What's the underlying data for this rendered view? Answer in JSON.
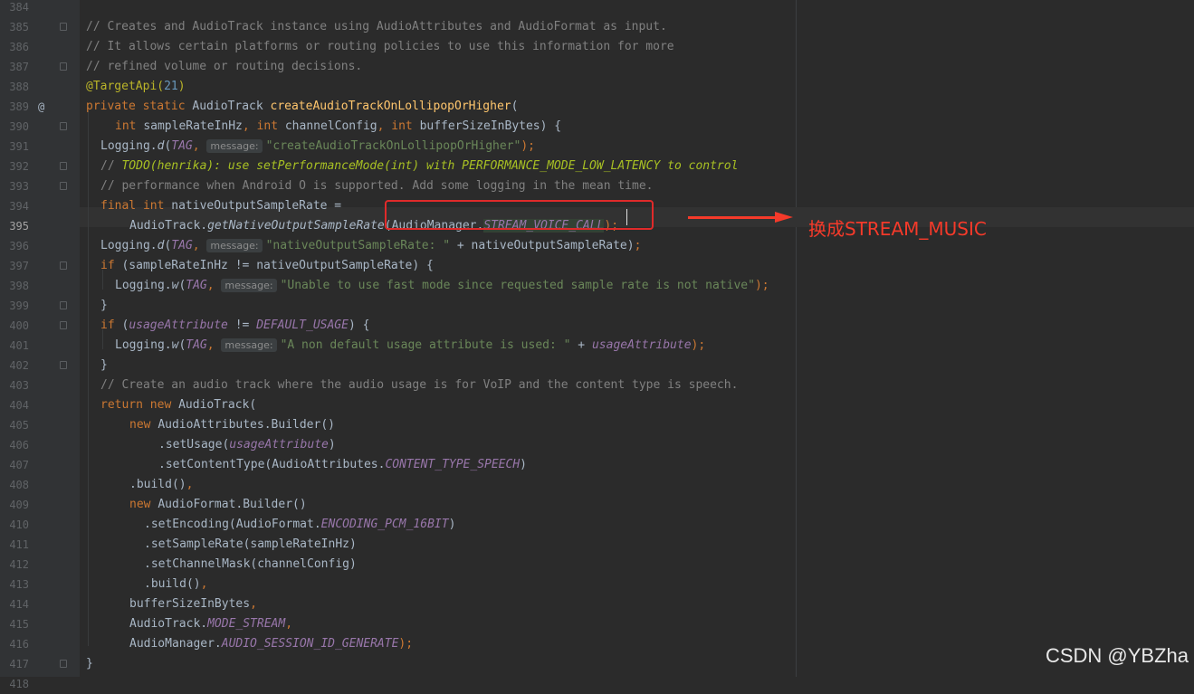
{
  "editor": {
    "current_line": "395",
    "lines": [
      {
        "n": "384",
        "fold": false,
        "icon": "",
        "indent": 95,
        "segments": []
      },
      {
        "n": "385",
        "fold": true,
        "icon": "",
        "indent": 95,
        "segments": [
          {
            "t": "// Creates and AudioTrack instance using AudioAttributes and AudioFormat as input.",
            "c": "cm"
          }
        ]
      },
      {
        "n": "386",
        "fold": false,
        "icon": "",
        "indent": 95,
        "segments": [
          {
            "t": "// It allows certain platforms or routing policies to use this information for more",
            "c": "cm"
          }
        ]
      },
      {
        "n": "387",
        "fold": true,
        "icon": "",
        "indent": 95,
        "segments": [
          {
            "t": "// refined volume or routing decisions.",
            "c": "cm"
          }
        ]
      },
      {
        "n": "388",
        "fold": false,
        "icon": "",
        "indent": 95,
        "segments": [
          {
            "t": "@TargetApi(",
            "c": "ann"
          },
          {
            "t": "21",
            "c": "num"
          },
          {
            "t": ")",
            "c": "ann"
          }
        ]
      },
      {
        "n": "389",
        "fold": false,
        "icon": "@",
        "indent": 95,
        "segments": [
          {
            "t": "private static ",
            "c": "kw"
          },
          {
            "t": "AudioTrack ",
            "c": ""
          },
          {
            "t": "createAudioTrackOnLollipopOrHigher",
            "c": "fn"
          },
          {
            "t": "(",
            "c": ""
          }
        ]
      },
      {
        "n": "390",
        "fold": true,
        "icon": "",
        "indent": 127,
        "segments": [
          {
            "t": "int ",
            "c": "kw"
          },
          {
            "t": "sampleRateInHz",
            "c": ""
          },
          {
            "t": ", ",
            "c": "kw"
          },
          {
            "t": "int ",
            "c": "kw"
          },
          {
            "t": "channelConfig",
            "c": ""
          },
          {
            "t": ", ",
            "c": "kw"
          },
          {
            "t": "int ",
            "c": "kw"
          },
          {
            "t": "bufferSizeInBytes",
            "c": ""
          },
          {
            "t": ") {",
            "c": ""
          }
        ]
      },
      {
        "n": "391",
        "fold": false,
        "icon": "",
        "indent": 111,
        "segments": [
          {
            "t": "Logging.",
            "c": ""
          },
          {
            "t": "d",
            "c": "mi"
          },
          {
            "t": "(",
            "c": ""
          },
          {
            "t": "TAG",
            "c": "st"
          },
          {
            "t": ", ",
            "c": "kw"
          },
          {
            "t": "message:",
            "c": "hint"
          },
          {
            "t": "\"createAudioTrackOnLollipopOrHigher\"",
            "c": "str"
          },
          {
            "t": ");",
            "c": "kw"
          }
        ]
      },
      {
        "n": "392",
        "fold": true,
        "icon": "",
        "indent": 111,
        "segments": [
          {
            "t": "// ",
            "c": "cm"
          },
          {
            "t": "TODO(henrika): use setPerformanceMode(int) with PERFORMANCE_MODE_LOW_LATENCY to control",
            "c": "todo"
          }
        ]
      },
      {
        "n": "393",
        "fold": true,
        "icon": "",
        "indent": 111,
        "segments": [
          {
            "t": "// performance when Android O is supported. Add some logging in the mean time.",
            "c": "cm"
          }
        ]
      },
      {
        "n": "394",
        "fold": false,
        "icon": "",
        "indent": 111,
        "segments": [
          {
            "t": "final int ",
            "c": "kw"
          },
          {
            "t": "nativeOutputSampleRate =",
            "c": ""
          }
        ]
      },
      {
        "n": "395",
        "fold": false,
        "icon": "",
        "indent": 143,
        "segments": [
          {
            "t": "AudioTrack.",
            "c": ""
          },
          {
            "t": "getNativeOutputSampleRate",
            "c": "mi"
          },
          {
            "t": "(AudioManager.",
            "c": ""
          },
          {
            "t": "STREAM_VOICE_CALL",
            "c": "st sel"
          },
          {
            "t": ");",
            "c": "kw"
          }
        ]
      },
      {
        "n": "396",
        "fold": false,
        "icon": "",
        "indent": 111,
        "segments": [
          {
            "t": "Logging.",
            "c": ""
          },
          {
            "t": "d",
            "c": "mi"
          },
          {
            "t": "(",
            "c": ""
          },
          {
            "t": "TAG",
            "c": "st"
          },
          {
            "t": ", ",
            "c": "kw"
          },
          {
            "t": "message:",
            "c": "hint"
          },
          {
            "t": "\"nativeOutputSampleRate: \"",
            "c": "str"
          },
          {
            "t": " + nativeOutputSampleRate)",
            "c": ""
          },
          {
            "t": ";",
            "c": "kw"
          }
        ]
      },
      {
        "n": "397",
        "fold": true,
        "icon": "",
        "indent": 111,
        "segments": [
          {
            "t": "if ",
            "c": "kw"
          },
          {
            "t": "(sampleRateInHz != nativeOutputSampleRate) {",
            "c": ""
          }
        ]
      },
      {
        "n": "398",
        "fold": false,
        "icon": "",
        "indent": 127,
        "segments": [
          {
            "t": "Logging.",
            "c": ""
          },
          {
            "t": "w",
            "c": "mi"
          },
          {
            "t": "(",
            "c": ""
          },
          {
            "t": "TAG",
            "c": "st"
          },
          {
            "t": ", ",
            "c": "kw"
          },
          {
            "t": "message:",
            "c": "hint"
          },
          {
            "t": "\"Unable to use fast mode since requested sample rate is not native\"",
            "c": "str"
          },
          {
            "t": ");",
            "c": "kw"
          }
        ]
      },
      {
        "n": "399",
        "fold": true,
        "icon": "",
        "indent": 111,
        "segments": [
          {
            "t": "}",
            "c": ""
          }
        ]
      },
      {
        "n": "400",
        "fold": true,
        "icon": "",
        "indent": 111,
        "segments": [
          {
            "t": "if ",
            "c": "kw"
          },
          {
            "t": "(",
            "c": ""
          },
          {
            "t": "usageAttribute",
            "c": "st"
          },
          {
            "t": " != ",
            "c": ""
          },
          {
            "t": "DEFAULT_USAGE",
            "c": "st"
          },
          {
            "t": ") {",
            "c": ""
          }
        ]
      },
      {
        "n": "401",
        "fold": false,
        "icon": "",
        "indent": 127,
        "segments": [
          {
            "t": "Logging.",
            "c": ""
          },
          {
            "t": "w",
            "c": "mi"
          },
          {
            "t": "(",
            "c": ""
          },
          {
            "t": "TAG",
            "c": "st"
          },
          {
            "t": ", ",
            "c": "kw"
          },
          {
            "t": "message:",
            "c": "hint"
          },
          {
            "t": "\"A non default usage attribute is used: \"",
            "c": "str"
          },
          {
            "t": " + ",
            "c": ""
          },
          {
            "t": "usageAttribute",
            "c": "st"
          },
          {
            "t": ");",
            "c": "kw"
          }
        ]
      },
      {
        "n": "402",
        "fold": true,
        "icon": "",
        "indent": 111,
        "segments": [
          {
            "t": "}",
            "c": ""
          }
        ]
      },
      {
        "n": "403",
        "fold": false,
        "icon": "",
        "indent": 111,
        "segments": [
          {
            "t": "// Create an audio track where the audio usage is for VoIP and the content type is speech.",
            "c": "cm"
          }
        ]
      },
      {
        "n": "404",
        "fold": false,
        "icon": "",
        "indent": 111,
        "segments": [
          {
            "t": "return new ",
            "c": "kw"
          },
          {
            "t": "AudioTrack(",
            "c": ""
          }
        ]
      },
      {
        "n": "405",
        "fold": false,
        "icon": "",
        "indent": 143,
        "segments": [
          {
            "t": "new ",
            "c": "kw"
          },
          {
            "t": "AudioAttributes.Builder()",
            "c": ""
          }
        ]
      },
      {
        "n": "406",
        "fold": false,
        "icon": "",
        "indent": 175,
        "segments": [
          {
            "t": ".setUsage(",
            "c": ""
          },
          {
            "t": "usageAttribute",
            "c": "st"
          },
          {
            "t": ")",
            "c": ""
          }
        ]
      },
      {
        "n": "407",
        "fold": false,
        "icon": "",
        "indent": 175,
        "segments": [
          {
            "t": ".setContentType(AudioAttributes.",
            "c": ""
          },
          {
            "t": "CONTENT_TYPE_SPEECH",
            "c": "st"
          },
          {
            "t": ")",
            "c": ""
          }
        ]
      },
      {
        "n": "408",
        "fold": false,
        "icon": "",
        "indent": 143,
        "segments": [
          {
            "t": ".build()",
            "c": ""
          },
          {
            "t": ",",
            "c": "kw"
          }
        ]
      },
      {
        "n": "409",
        "fold": false,
        "icon": "",
        "indent": 143,
        "segments": [
          {
            "t": "new ",
            "c": "kw"
          },
          {
            "t": "AudioFormat.Builder()",
            "c": ""
          }
        ]
      },
      {
        "n": "410",
        "fold": false,
        "icon": "",
        "indent": 159,
        "segments": [
          {
            "t": ".setEncoding(AudioFormat.",
            "c": ""
          },
          {
            "t": "ENCODING_PCM_16BIT",
            "c": "st"
          },
          {
            "t": ")",
            "c": ""
          }
        ]
      },
      {
        "n": "411",
        "fold": false,
        "icon": "",
        "indent": 159,
        "segments": [
          {
            "t": ".setSampleRate(sampleRateInHz)",
            "c": ""
          }
        ]
      },
      {
        "n": "412",
        "fold": false,
        "icon": "",
        "indent": 159,
        "segments": [
          {
            "t": ".setChannelMask(channelConfig)",
            "c": ""
          }
        ]
      },
      {
        "n": "413",
        "fold": false,
        "icon": "",
        "indent": 159,
        "segments": [
          {
            "t": ".build()",
            "c": ""
          },
          {
            "t": ",",
            "c": "kw"
          }
        ]
      },
      {
        "n": "414",
        "fold": false,
        "icon": "",
        "indent": 143,
        "segments": [
          {
            "t": "bufferSizeInBytes",
            "c": ""
          },
          {
            "t": ",",
            "c": "kw"
          }
        ]
      },
      {
        "n": "415",
        "fold": false,
        "icon": "",
        "indent": 143,
        "segments": [
          {
            "t": "AudioTrack.",
            "c": ""
          },
          {
            "t": "MODE_STREAM",
            "c": "st"
          },
          {
            "t": ",",
            "c": "kw"
          }
        ]
      },
      {
        "n": "416",
        "fold": false,
        "icon": "",
        "indent": 143,
        "segments": [
          {
            "t": "AudioManager.",
            "c": ""
          },
          {
            "t": "AUDIO_SESSION_ID_GENERATE",
            "c": "st"
          },
          {
            "t": ");",
            "c": "kw"
          }
        ]
      },
      {
        "n": "417",
        "fold": true,
        "icon": "",
        "indent": 95,
        "segments": [
          {
            "t": "}",
            "c": ""
          }
        ]
      },
      {
        "n": "418",
        "fold": false,
        "icon": "",
        "indent": 95,
        "segments": []
      }
    ]
  },
  "annotation": {
    "note": "换成STREAM_MUSIC",
    "color": "#f53a2a"
  },
  "watermark": "CSDN @YBZha",
  "icons": {
    "override": "at-icon",
    "fold": "fold-marker-icon",
    "arrow": "red-arrow-icon"
  }
}
